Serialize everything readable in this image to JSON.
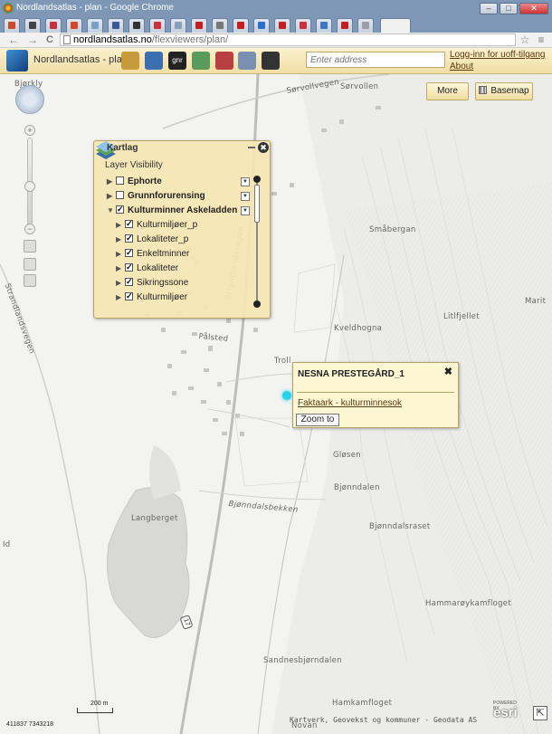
{
  "window": {
    "title": "Nordlandsatlas - plan - Google Chrome",
    "minimize_glyph": "–",
    "maximize_glyph": "□",
    "close_glyph": "✕"
  },
  "tabs": [
    {
      "color": "#c84a2a"
    },
    {
      "color": "#444444"
    },
    {
      "color": "#c8323c"
    },
    {
      "color": "#d04a2a"
    },
    {
      "color": "#7aa0c8"
    },
    {
      "color": "#3b5998"
    },
    {
      "color": "#333333"
    },
    {
      "color": "#c8323c"
    },
    {
      "color": "#8aa0b8"
    },
    {
      "color": "#c41e1e"
    },
    {
      "color": "#777777"
    },
    {
      "color": "#c41e1e"
    },
    {
      "color": "#2a6fd0"
    },
    {
      "color": "#c41e1e"
    },
    {
      "color": "#c8323c"
    },
    {
      "color": "#3b78c8"
    },
    {
      "color": "#c41e1e"
    },
    {
      "color": "#9aa0a6"
    }
  ],
  "browser": {
    "url_domain": "nordlandsatlas.no",
    "url_path": "/flexviewers/plan/",
    "back_glyph": "←",
    "forward_glyph": "→",
    "reload_glyph": "C",
    "star_glyph": "☆",
    "menu_glyph": "≡"
  },
  "app": {
    "title": "Nordlandsatlas - plan",
    "address_placeholder": "Enter address",
    "login_link": "Logg-inn for uoff-tilgang",
    "about_link": "About",
    "more_button": "More",
    "basemap_button": "Basemap",
    "tool_icons": [
      "globe-tool-icon",
      "print-tool-icon",
      "gnr-tool-icon",
      "measure-tool-icon",
      "bookmark-tool-icon",
      "layers-tool-icon",
      "binoculars-tool-icon"
    ],
    "gnr_label": "gnr"
  },
  "zoom": {
    "plus_glyph": "+",
    "minus_glyph": "−",
    "level_pct": 45
  },
  "layer_panel": {
    "title": "Kartlag",
    "close_glyph": "✖",
    "section_title": "Layer Visibility",
    "option_glyph": "▼",
    "layers": [
      {
        "label": "Ephorte",
        "checked": false,
        "expanded": false,
        "bold": true,
        "indent": 0
      },
      {
        "label": "Grunnforurensing",
        "checked": false,
        "expanded": false,
        "bold": true,
        "indent": 0
      },
      {
        "label": "Kulturminner Askeladden",
        "checked": true,
        "expanded": true,
        "bold": true,
        "indent": 0
      },
      {
        "label": "Kulturmiljøer_p",
        "checked": true,
        "expanded": false,
        "bold": false,
        "indent": 1
      },
      {
        "label": "Lokaliteter_p",
        "checked": true,
        "expanded": false,
        "bold": false,
        "indent": 1
      },
      {
        "label": "Enkeltminner",
        "checked": true,
        "expanded": false,
        "bold": false,
        "indent": 1
      },
      {
        "label": "Lokaliteter",
        "checked": true,
        "expanded": false,
        "bold": false,
        "indent": 1
      },
      {
        "label": "Sikringssone",
        "checked": true,
        "expanded": false,
        "bold": false,
        "indent": 1
      },
      {
        "label": "Kulturmiljøer",
        "checked": true,
        "expanded": false,
        "bold": false,
        "indent": 1
      }
    ]
  },
  "popup": {
    "title": "NESNA PRESTEGÅRD_1",
    "close_glyph": "✖",
    "link": "Faktaark - kulturminnesok",
    "zoom_button": "Zoom to"
  },
  "map_labels": [
    {
      "text": "Bjørkly",
      "name": "place-bjorkly"
    },
    {
      "text": "Sørvollen",
      "name": "place-sorvollen"
    },
    {
      "text": "Sørvollvegen",
      "name": "road-sorvollvegen"
    },
    {
      "text": "Småbergan",
      "name": "place-smabergan"
    },
    {
      "text": "Marit",
      "name": "place-marit"
    },
    {
      "text": "Litlfjellet",
      "name": "place-litlfjellet"
    },
    {
      "text": "Kveldhogna",
      "name": "place-kveldhogna"
    },
    {
      "text": "Troll",
      "name": "place-troll"
    },
    {
      "text": "Strandlandsvegen",
      "name": "road-strandlandsvegen"
    },
    {
      "text": "Strandlandsvegen",
      "name": "road-strandlandsvegen-west"
    },
    {
      "text": "Pålsted",
      "name": "road-palsted"
    },
    {
      "text": "Gløsen",
      "name": "place-glosen"
    },
    {
      "text": "Bjønndalen",
      "name": "place-bjonndalen"
    },
    {
      "text": "Bjønndalsbekken",
      "name": "stream-bjonndalsbekken"
    },
    {
      "text": "Langberget",
      "name": "place-langberget"
    },
    {
      "text": "Bjønndalsraset",
      "name": "place-bjonndalsraset"
    },
    {
      "text": "Hammarøykamfloget",
      "name": "place-hammaroykamfloget"
    },
    {
      "text": "Sandnesbjørndalen",
      "name": "place-sandnesbjorndalen"
    },
    {
      "text": "Hamkamfloget",
      "name": "place-hamkamfloget"
    },
    {
      "text": "Novan",
      "name": "place-novan"
    },
    {
      "text": "Id",
      "name": "place-id-edge"
    }
  ],
  "route_shield": "17",
  "scale": {
    "label": "200 m"
  },
  "coordinates": "411837 7343218",
  "attribution": "Kartverk, Geovekst og kommuner - Geodata AS",
  "esri": {
    "logo": "esri",
    "powered": "POWERED BY"
  },
  "resize_glyph": "⇱"
}
